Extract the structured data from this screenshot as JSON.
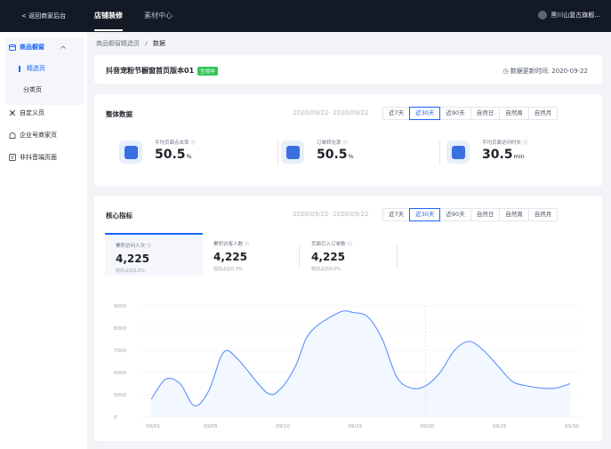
{
  "topbar": {
    "back_label": "< 返回商家后台",
    "tabs": [
      {
        "label": "店铺装修"
      },
      {
        "label": "素材中心"
      }
    ],
    "shop_name": "黑川山复古旗舰..."
  },
  "sidebar": {
    "group_label": "商品橱窗",
    "sub_items": [
      {
        "label": "精选页"
      },
      {
        "label": "分类页"
      }
    ],
    "items": [
      {
        "label": "自定义页"
      },
      {
        "label": "企业号商家页"
      },
      {
        "label": "非抖音端页面"
      }
    ]
  },
  "breadcrumb": {
    "parent": "商品橱窗精选页",
    "sep": "/",
    "current": "数据"
  },
  "page": {
    "title": "抖音宠粉节橱窗首页版本01",
    "badge": "生效中",
    "update_text": "◷ 数据更新时间: 2020-09-22"
  },
  "overview": {
    "title": "整体数据",
    "date_range": "2020/09/22- 2020/09/22",
    "ranges": [
      "近7天",
      "近30天",
      "近90天",
      "自然日",
      "自然周",
      "自然月"
    ],
    "active_range": 1,
    "kpis": [
      {
        "label": "平均页面点击率 ⓘ",
        "value": "50.5",
        "unit": "%"
      },
      {
        "label": "订单转化率 ⓘ",
        "value": "50.5",
        "unit": "%"
      },
      {
        "label": "平均页面访问时长 ⓘ",
        "value": "30.5",
        "unit": "min"
      }
    ]
  },
  "core": {
    "title": "核心指标",
    "date_range": "2020/09/22- 2020/09/22",
    "ranges": [
      "近7天",
      "近30天",
      "近90天",
      "自然日",
      "自然周",
      "自然月"
    ],
    "active_range": 1,
    "metrics": [
      {
        "label": "累积访问人次 ⓘ",
        "value": "4,225",
        "compare": "较前占比0.0%"
      },
      {
        "label": "累积访客人数 ⓘ",
        "value": "4,225",
        "compare": "较前占比0.0%"
      },
      {
        "label": "页面引入订单数 ⓘ",
        "value": "4,225",
        "compare": "较前占比0.0%"
      }
    ]
  },
  "chart_data": {
    "type": "area",
    "x_ticks": [
      "09/01",
      "09/05",
      "09/10",
      "09/15",
      "09/20",
      "09/25",
      "09/30"
    ],
    "y_ticks": [
      "0",
      "5000",
      "6000",
      "7000",
      "8000",
      "9000"
    ],
    "series": [
      {
        "x": [
          1,
          2,
          3,
          4,
          5,
          6,
          7,
          9,
          10,
          11,
          12,
          14,
          15,
          16,
          17,
          18,
          19,
          20,
          21,
          22,
          23,
          24,
          25,
          26,
          27,
          28,
          29,
          30
        ],
        "values": [
          4800,
          5700,
          5500,
          4500,
          5200,
          6900,
          6600,
          5100,
          5300,
          6300,
          7800,
          8700,
          8700,
          8500,
          7500,
          5800,
          5300,
          5400,
          6000,
          7000,
          7400,
          7000,
          6300,
          5600,
          5400,
          5300,
          5300,
          5500
        ]
      }
    ],
    "colors": {
      "line": "#5b8ff9",
      "fill": "#eef3ff"
    }
  }
}
